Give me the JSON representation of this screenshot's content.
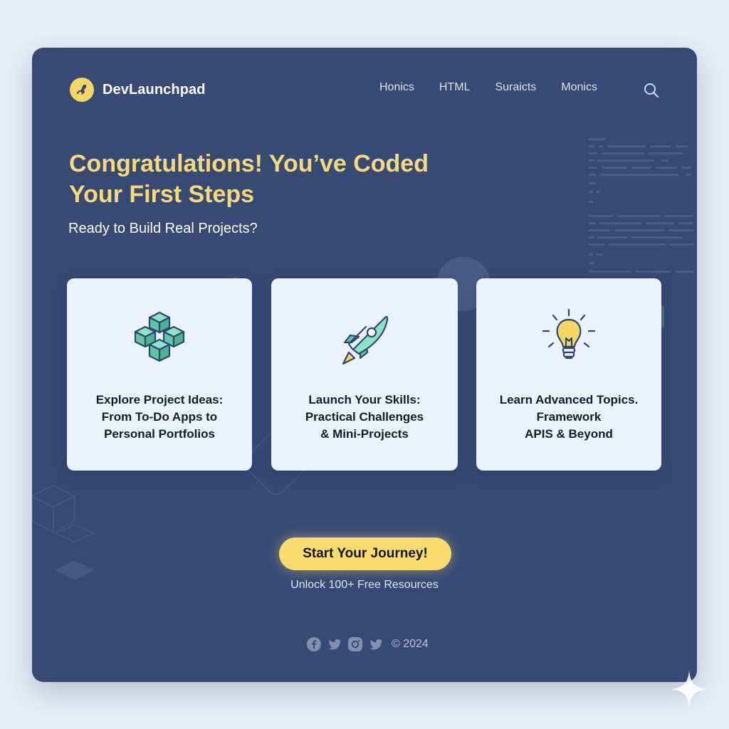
{
  "brand": {
    "name": "DevLaunchpad",
    "logo_icon": "rocket-swirl-icon"
  },
  "nav": {
    "items": [
      "Honics",
      "HTML",
      "Suraicts",
      "Monics"
    ],
    "search_icon": "search-icon"
  },
  "hero": {
    "headline_line1": "Congratulations! You’ve Coded",
    "headline_line2": "Your First Steps",
    "subheadline": "Ready to Build Real Projects?"
  },
  "cards": [
    {
      "icon": "cubes-icon",
      "lines": [
        "Explore Project Ideas:",
        "From To-Do Apps to",
        "Personal Portfolios"
      ]
    },
    {
      "icon": "rocket-icon",
      "lines": [
        "Launch Your Skills:",
        "Practical Challenges",
        "& Mini-Projects"
      ]
    },
    {
      "icon": "lightbulb-icon",
      "lines": [
        "Learn Advanced Topics.",
        "Framework",
        "APIS & Beyond"
      ]
    }
  ],
  "cta": {
    "label": "Start Your Journey!",
    "note": "Unlock 100+ Free Resources"
  },
  "footer": {
    "social_icons": [
      "facebook-icon",
      "twitter-icon",
      "instagram-icon",
      "twitter-icon"
    ],
    "copyright": "© 2024"
  },
  "colors": {
    "background": "#e6eef6",
    "panel": "#364a74",
    "accent_yellow": "#f6d97a",
    "card": "#ebf2fc",
    "icon_teal": "#6fd0b0"
  }
}
